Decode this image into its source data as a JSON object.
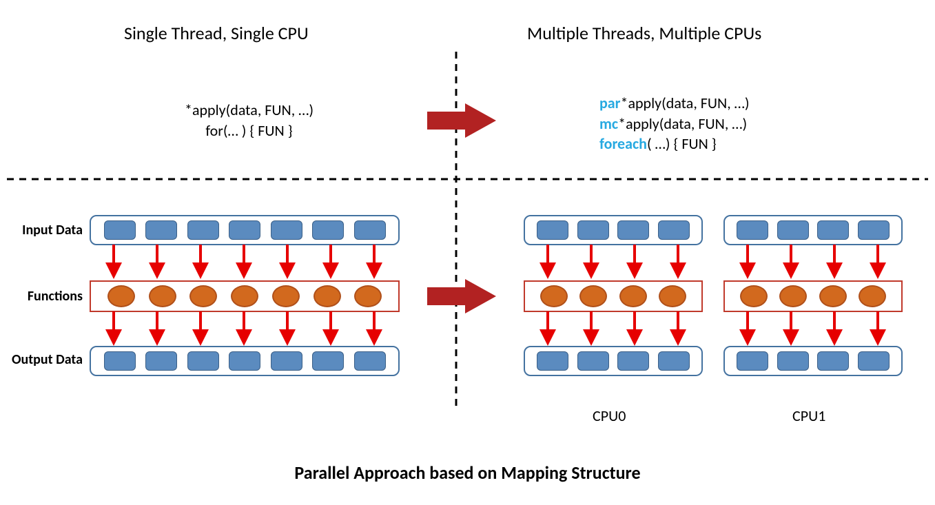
{
  "headings": {
    "left": "Single Thread, Single CPU",
    "right": "Multiple Threads, Multiple CPUs"
  },
  "code": {
    "left_line1": "*apply(data, FUN, …)",
    "left_line2": "for(… ) { FUN }",
    "right_par_kw": "par",
    "right_par_rest": "*apply(data, FUN, …)",
    "right_mc_kw": "mc",
    "right_mc_rest": "*apply(data, FUN, …)",
    "right_foreach_kw": "foreach",
    "right_foreach_rest": "( …)  { FUN }"
  },
  "labels": {
    "input": "Input Data",
    "functions": "Functions",
    "output": "Output Data",
    "cpu0": "CPU0",
    "cpu1": "CPU1"
  },
  "title": "Parallel Approach based on Mapping Structure",
  "diagram": {
    "left_cells": 7,
    "right_cells_per_cpu": 4,
    "cpus": 2
  }
}
